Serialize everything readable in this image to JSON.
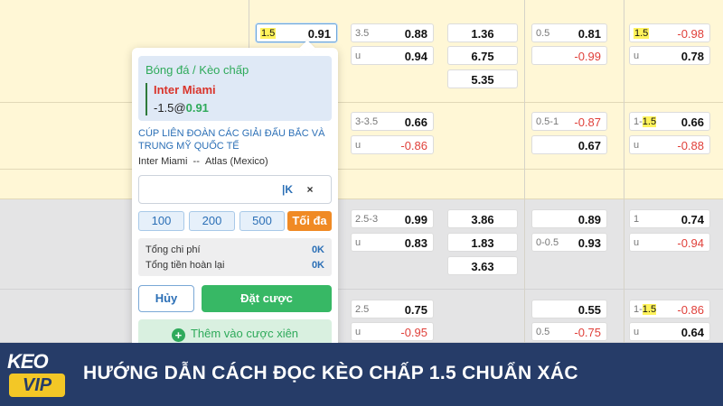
{
  "table": {
    "row1": {
      "c1": {
        "handicap": "1.5",
        "odds": "0.91"
      },
      "c2": {
        "handicap": "3.5",
        "odds": "0.88"
      },
      "c3": {
        "odds": "1.36"
      },
      "c4": {
        "handicap": "0.5",
        "odds": "0.81"
      },
      "c5": {
        "handicap": "1.5",
        "odds": "-0.98"
      },
      "c2b": {
        "handicap": "u",
        "odds": "0.94"
      },
      "c3b": {
        "odds": "6.75"
      },
      "c4b": {
        "odds": "-0.99"
      },
      "c5b": {
        "handicap": "u",
        "odds": "0.78"
      },
      "c3c": {
        "odds": "5.35"
      }
    },
    "row2": {
      "c2": {
        "handicap": "3-3.5",
        "odds": "0.66"
      },
      "c4": {
        "handicap": "0.5-1",
        "odds": "-0.87"
      },
      "c5": {
        "handicap_prefix": "1-",
        "handicap_hl": "1.5",
        "odds": "0.66"
      },
      "c2b": {
        "handicap": "u",
        "odds": "-0.86"
      },
      "c4b": {
        "odds": "0.67"
      },
      "c5b": {
        "handicap": "u",
        "odds": "-0.88"
      }
    },
    "row3": {
      "c2": {
        "handicap": "2.5-3",
        "odds": "0.99"
      },
      "c3": {
        "odds": "3.86"
      },
      "c4": {
        "odds": "0.89"
      },
      "c5": {
        "handicap": "1",
        "odds": "0.74"
      },
      "c2b": {
        "handicap": "u",
        "odds": "0.83"
      },
      "c3b": {
        "odds": "1.83"
      },
      "c4b": {
        "handicap": "0-0.5",
        "odds": "0.93"
      },
      "c5b": {
        "handicap": "u",
        "odds": "-0.94"
      },
      "c3c": {
        "odds": "3.63"
      }
    },
    "row4": {
      "c2": {
        "handicap": "2.5",
        "odds": "0.75"
      },
      "c4": {
        "odds": "0.55"
      },
      "c5": {
        "handicap_prefix": "1-",
        "handicap_hl": "1.5",
        "odds": "-0.86"
      },
      "c2b": {
        "handicap": "u",
        "odds": "-0.95"
      },
      "c4b": {
        "handicap": "0.5",
        "odds": "-0.75"
      },
      "c5b": {
        "handicap": "u",
        "odds": "0.64"
      }
    }
  },
  "betslip": {
    "breadcrumb": "Bóng đá / Kèo chấp",
    "team": "Inter Miami",
    "pick_line": "-1.5",
    "pick_at": "@",
    "pick_odds": "0.91",
    "league": "CÚP LIÊN ĐOÀN CÁC GIẢI ĐẤU BẮC VÀ TRUNG MỸ QUỐC TẾ",
    "home": "Inter Miami",
    "vs": "--",
    "away": "Atlas (Mexico)",
    "stake_value": "",
    "stake_suffix": "K",
    "clear_icon": "×",
    "quick": [
      "100",
      "200",
      "500"
    ],
    "max_label": "Tối đa",
    "total_cost_label": "Tổng chi phí",
    "total_cost_value": "0K",
    "total_return_label": "Tổng tiền hoàn lại",
    "total_return_value": "0K",
    "cancel_label": "Hủy",
    "place_label": "Đặt cược",
    "parlay_label": "Thêm vào cược xiên"
  },
  "banner": {
    "logo_top": "KEO",
    "logo_bottom": "VIP",
    "headline": "HƯỚNG DẪN CÁCH ĐỌC KÈO CHẤP 1.5 CHUẨN XÁC"
  },
  "colors": {
    "positive": "#111111",
    "negative": "#e0403a",
    "accent_green": "#37b865",
    "banner_bg": "#263c68",
    "logo_yellow": "#f3c726"
  }
}
